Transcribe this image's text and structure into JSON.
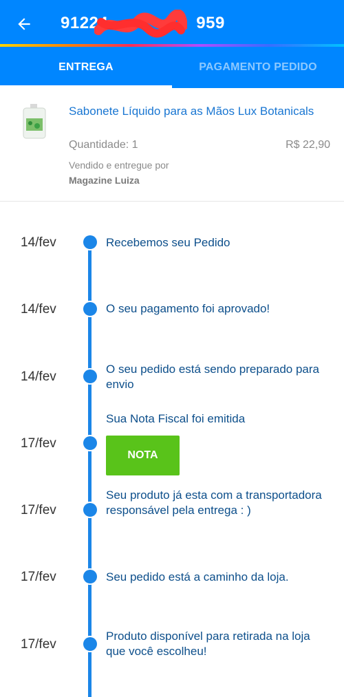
{
  "header": {
    "title": "91224",
    "title_suffix": "959",
    "colors": {
      "primary": "#0086ff",
      "timeline": "#1b86e8",
      "button": "#59c31a",
      "link": "#1976d2"
    }
  },
  "tabs": [
    {
      "label": "ENTREGA",
      "active": true
    },
    {
      "label": "PAGAMENTO PEDIDO",
      "active": false
    }
  ],
  "product": {
    "name": "Sabonete Líquido para as Mãos Lux Botanicals",
    "quantity": "Quantidade: 1",
    "price": "R$ 22,90",
    "sold_by_label": "Vendido e entregue por",
    "seller": "Magazine Luiza"
  },
  "timeline": [
    {
      "date": "14/fev",
      "text": "Recebemos seu Pedido"
    },
    {
      "date": "14/fev",
      "text": "O seu pagamento foi aprovado!"
    },
    {
      "date": "14/fev",
      "text": "O seu pedido está sendo preparado para envio"
    },
    {
      "date": "17/fev",
      "text": "Sua Nota Fiscal foi emitida",
      "button": "NOTA"
    },
    {
      "date": "17/fev",
      "text": "Seu produto já esta com a transportadora responsável pela entrega : )"
    },
    {
      "date": "17/fev",
      "text": "Seu pedido está a caminho da loja."
    },
    {
      "date": "17/fev",
      "text": "Produto disponível para retirada na loja que você escolheu!"
    }
  ]
}
